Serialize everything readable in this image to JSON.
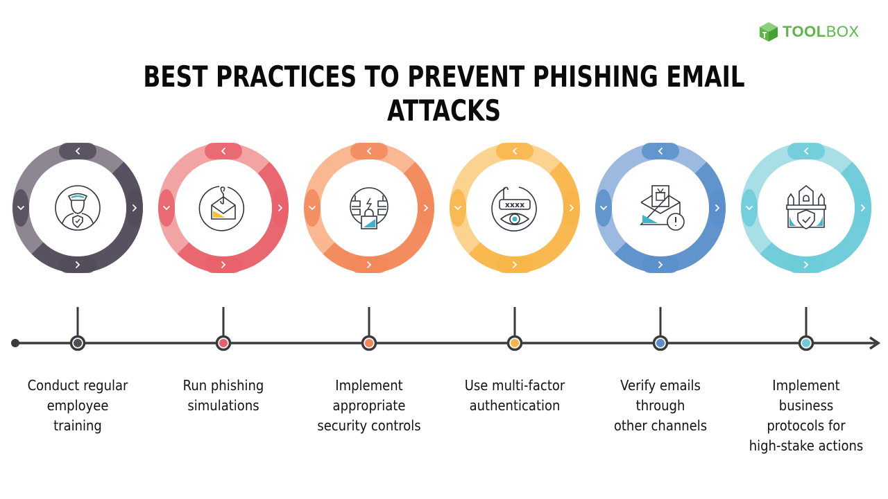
{
  "brand": {
    "name_bold": "TOOL",
    "name_light": "BOX",
    "color": "#5cb648"
  },
  "title": "BEST PRACTICES TO PREVENT PHISHING EMAIL ATTACKS",
  "steps": [
    {
      "icon": "security-guard-icon",
      "color_dark": "#524b5a",
      "color_light": "#8e8793",
      "accent": "#3db4cc",
      "lines": [
        "Conduct regular",
        "employee",
        "training"
      ]
    },
    {
      "icon": "phishing-hook-envelope-icon",
      "color_dark": "#e8606a",
      "color_light": "#f2a3a3",
      "accent": "#f5c232",
      "lines": [
        "Run phishing",
        "simulations"
      ]
    },
    {
      "icon": "firewall-lock-icon",
      "color_dark": "#f2875a",
      "color_light": "#f9b892",
      "accent": "#3db4cc",
      "lines": [
        "Implement",
        "appropriate",
        "security controls"
      ]
    },
    {
      "icon": "password-eye-icon",
      "color_dark": "#f8b549",
      "color_light": "#fbd28e",
      "accent": "#3db4cc",
      "lines": [
        "Use multi-factor",
        "authentication"
      ]
    },
    {
      "icon": "email-warning-icon",
      "color_dark": "#5b8fcb",
      "color_light": "#9cb9df",
      "accent": "#3db4cc",
      "lines": [
        "Verify emails",
        "through",
        "other channels"
      ]
    },
    {
      "icon": "castle-shield-icon",
      "color_dark": "#6ccbd9",
      "color_light": "#a8dfe7",
      "accent": "#3db4cc",
      "lines": [
        "Implement",
        "business",
        "protocols for",
        "high-stake actions"
      ]
    }
  ],
  "timeline": {
    "line_color": "#3a3a3a"
  }
}
